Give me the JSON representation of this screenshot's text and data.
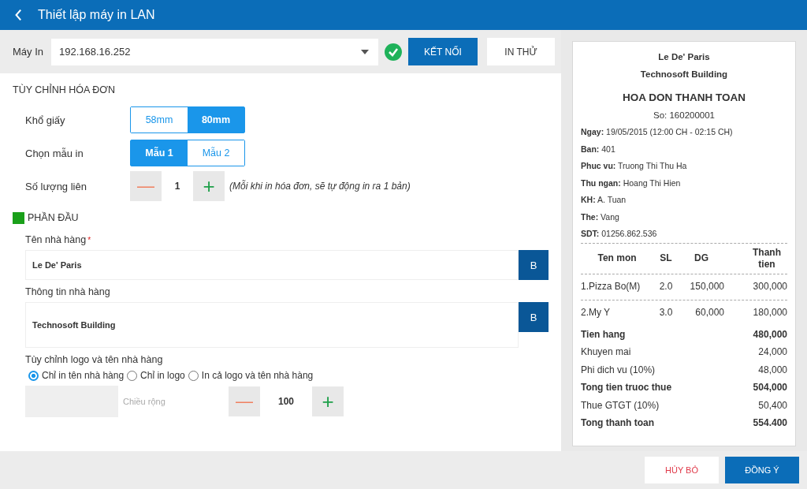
{
  "header": {
    "title": "Thiết lập máy in LAN"
  },
  "printer": {
    "label": "Máy In",
    "value": "192.168.16.252",
    "connected": true,
    "connect_button": "KẾT NỐI",
    "test_button": "IN THỬ"
  },
  "section_title": "TÙY CHỈNH HÓA ĐƠN",
  "paper_size": {
    "label": "Khổ giấy",
    "options": [
      {
        "label": "58mm",
        "selected": false
      },
      {
        "label": "80mm",
        "selected": true
      }
    ]
  },
  "template": {
    "label": "Chọn mẫu in",
    "options": [
      {
        "label": "Mẫu 1",
        "selected": true
      },
      {
        "label": "Mẫu 2",
        "selected": false
      }
    ]
  },
  "copies": {
    "label": "Số lượng liên",
    "minus": "—",
    "value": "1",
    "plus": "+",
    "hint": "(Mỗi khi in hóa đơn, sẽ tự động in ra 1 bản)"
  },
  "header_section": {
    "title": "PHẦN ĐẦU",
    "color": "#1aa01a"
  },
  "name_field": {
    "label": "Tên nhà hàng",
    "required_mark": "*",
    "value": "Le De' Paris",
    "bold_button": "B"
  },
  "info_field": {
    "label": "Thông tin nhà hàng",
    "value": "Technosoft Building",
    "bold_button": "B"
  },
  "logo_options": {
    "label": "Tùy chỉnh logo và tên nhà hàng",
    "options": [
      {
        "label": "Chỉ in tên nhà hàng",
        "selected": true
      },
      {
        "label": "Chỉ in logo",
        "selected": false
      },
      {
        "label": "In cả logo và tên nhà hàng",
        "selected": false
      }
    ]
  },
  "logo_width": {
    "label": "Chiều rộng",
    "minus": "—",
    "value": "100",
    "plus": "+"
  },
  "receipt": {
    "name": "Le De' Paris",
    "info": "Technosoft Building",
    "title": "HOA DON THANH TOAN",
    "number": "So: 160200001",
    "fields": [
      "**Ngay:** 19/05/2015 (12:00 CH - 02:15 CH)",
      "**Ban:** 401",
      "**Phuc vu:** Truong Thi Thu Ha",
      "**Thu ngan:** Hoang Thi Hien",
      "**KH:** A. Tuan",
      "**The:** Vang",
      "**SDT:** 01256.862.536"
    ],
    "columns": [
      "Ten mon",
      "SL",
      "DG",
      "Thanh tien"
    ],
    "items": [
      [
        "1.Pizza Bo(M)",
        "2.0",
        "150,000",
        "300,000"
      ],
      [
        "2.My Y",
        "3.0",
        "60,000",
        "180,000"
      ]
    ],
    "totals": [
      {
        "label": "Tien hang",
        "value": "480,000",
        "bold": true
      },
      {
        "label": "Khuyen mai",
        "value": "24,000",
        "bold": false
      },
      {
        "label": "Phi dich vu (10%)",
        "value": "48,000",
        "bold": false
      },
      {
        "label": "Tong tien truoc thue",
        "value": "504,000",
        "bold": true
      },
      {
        "label": "Thue GTGT (10%)",
        "value": "50,400",
        "bold": false
      },
      {
        "label": "Tong thanh toan",
        "value": "554.400",
        "bold": true
      }
    ]
  },
  "footer": {
    "cancel": "HỦY BỎ",
    "ok": "ĐỒNG Ý"
  }
}
